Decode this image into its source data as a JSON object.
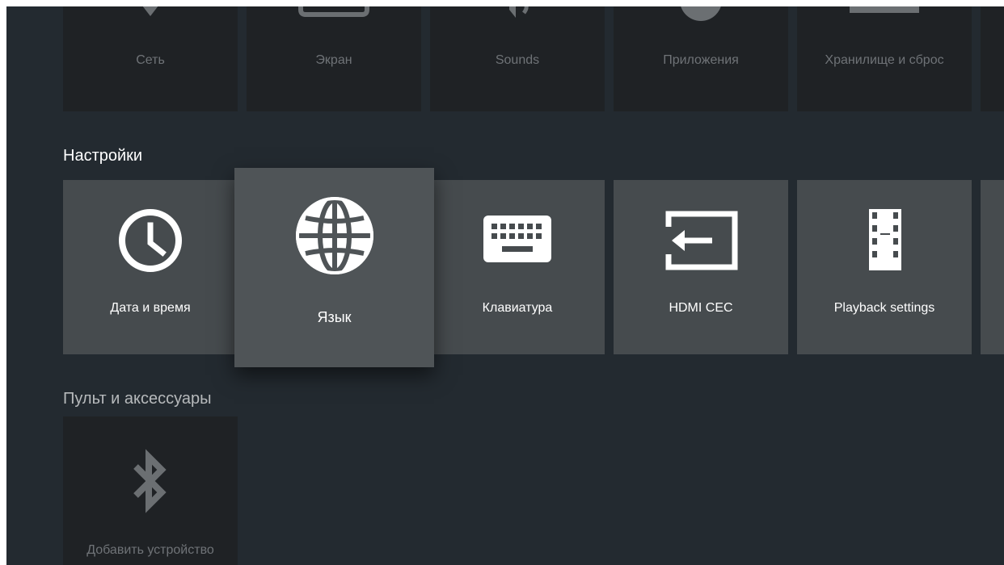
{
  "top_row": {
    "tiles": [
      {
        "label": "Сеть",
        "icon": "network-icon"
      },
      {
        "label": "Экран",
        "icon": "screen-icon"
      },
      {
        "label": "Sounds",
        "icon": "sound-icon"
      },
      {
        "label": "Приложения",
        "icon": "apps-icon"
      },
      {
        "label": "Хранилище и сброс",
        "icon": "storage-icon"
      }
    ]
  },
  "settings": {
    "title": "Настройки",
    "tiles": [
      {
        "label": "Дата и время",
        "icon": "clock-icon"
      },
      {
        "label": "Язык",
        "icon": "globe-icon",
        "focused": true
      },
      {
        "label": "Клавиатура",
        "icon": "keyboard-icon"
      },
      {
        "label": "HDMI CEC",
        "icon": "hdmi-input-icon"
      },
      {
        "label": "Playback settings",
        "icon": "film-icon"
      }
    ]
  },
  "remote": {
    "title": "Пульт и аксессуары",
    "tiles": [
      {
        "label": "Добавить устройство",
        "icon": "bluetooth-icon"
      }
    ]
  },
  "colors": {
    "background": "#232a30",
    "tile": "#464b4e",
    "tile_focused": "#4f5457",
    "tile_dim": "#1f2225"
  }
}
